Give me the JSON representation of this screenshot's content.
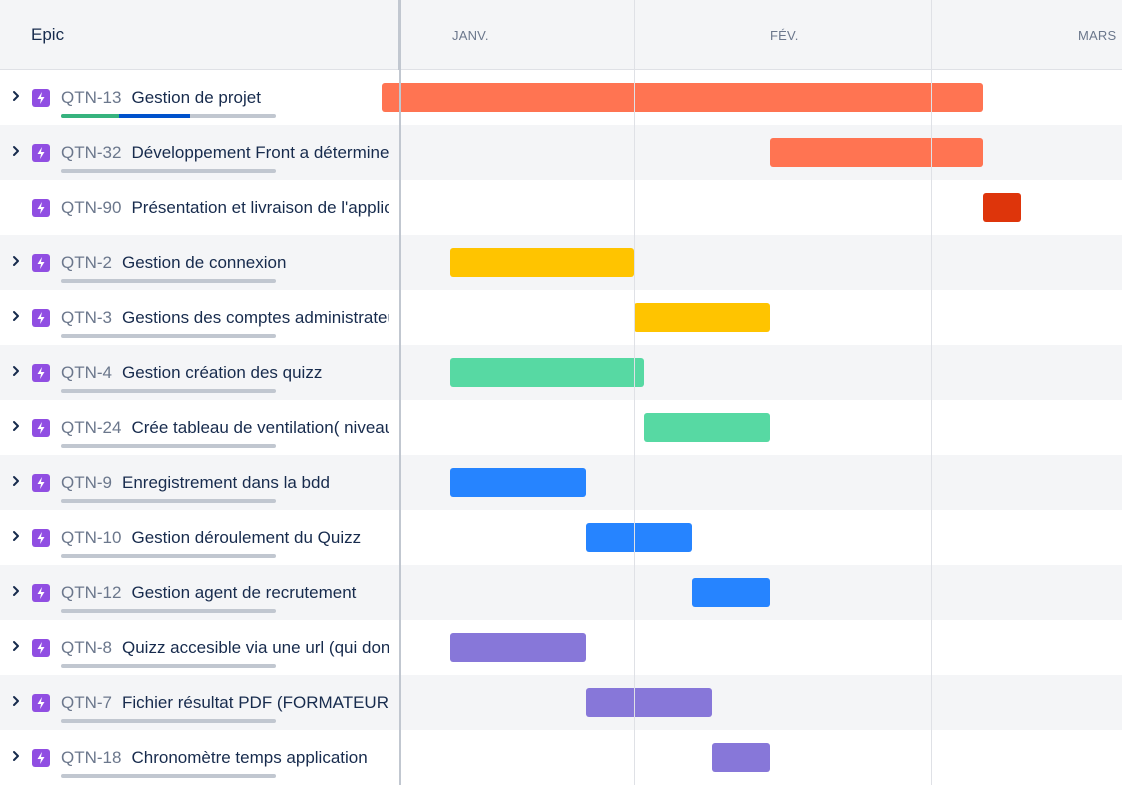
{
  "header": {
    "epic_label": "Epic"
  },
  "months": [
    "JANV.",
    "FÉV.",
    "MARS"
  ],
  "rows": [
    {
      "key": "QTN-13",
      "title": "Gestion de projet",
      "expandable": true,
      "progress": {
        "done": 0.27,
        "in_progress": 0.33
      },
      "bar": {
        "start": "Jan 06",
        "end": "Mar 09"
      },
      "color": "#ff7452"
    },
    {
      "key": "QTN-32",
      "title": "Développement Front a déterminer",
      "expandable": true,
      "progress": {
        "done": 0,
        "in_progress": 0
      },
      "bar": {
        "start": "Feb 15",
        "end": "Mar 09"
      },
      "color": "#ff7452"
    },
    {
      "key": "QTN-90",
      "title": "Présentation et livraison de l'application",
      "expandable": false,
      "progress": null,
      "bar": {
        "start": "Mar 09",
        "end": "Mar 13"
      },
      "color": "#de350b"
    },
    {
      "key": "QTN-2",
      "title": "Gestion de connexion",
      "expandable": true,
      "progress": {
        "done": 0,
        "in_progress": 0
      },
      "bar": {
        "start": "Jan 13",
        "end": "Feb 01"
      },
      "color": "#ffc400"
    },
    {
      "key": "QTN-3",
      "title": "Gestions des comptes administrateurs",
      "expandable": true,
      "progress": {
        "done": 0,
        "in_progress": 0
      },
      "bar": {
        "start": "Feb 01",
        "end": "Feb 15"
      },
      "color": "#ffc400"
    },
    {
      "key": "QTN-4",
      "title": "Gestion création des quizz",
      "expandable": true,
      "progress": {
        "done": 0,
        "in_progress": 0
      },
      "bar": {
        "start": "Jan 13",
        "end": "Feb 02"
      },
      "color": "#57d9a3"
    },
    {
      "key": "QTN-24",
      "title": "Crée tableau de ventilation( niveau)",
      "expandable": true,
      "progress": {
        "done": 0,
        "in_progress": 0
      },
      "bar": {
        "start": "Feb 02",
        "end": "Feb 15"
      },
      "color": "#57d9a3"
    },
    {
      "key": "QTN-9",
      "title": "Enregistrement dans la bdd",
      "expandable": true,
      "progress": {
        "done": 0,
        "in_progress": 0
      },
      "bar": {
        "start": "Jan 13",
        "end": "Jan 27"
      },
      "color": "#2684ff"
    },
    {
      "key": "QTN-10",
      "title": "Gestion déroulement du Quizz",
      "expandable": true,
      "progress": {
        "done": 0,
        "in_progress": 0
      },
      "bar": {
        "start": "Jan 27",
        "end": "Feb 07"
      },
      "color": "#2684ff"
    },
    {
      "key": "QTN-12",
      "title": "Gestion agent de recrutement",
      "expandable": true,
      "progress": {
        "done": 0,
        "in_progress": 0
      },
      "bar": {
        "start": "Feb 07",
        "end": "Feb 15"
      },
      "color": "#2684ff"
    },
    {
      "key": "QTN-8",
      "title": "Quizz accesible via une url (qui donne accès)",
      "expandable": true,
      "progress": {
        "done": 0,
        "in_progress": 0
      },
      "bar": {
        "start": "Jan 13",
        "end": "Jan 27"
      },
      "color": "#8777d9"
    },
    {
      "key": "QTN-7",
      "title": "Fichier résultat PDF (FORMATEUR)",
      "expandable": true,
      "progress": {
        "done": 0,
        "in_progress": 0
      },
      "bar": {
        "start": "Jan 27",
        "end": "Feb 09"
      },
      "color": "#8777d9"
    },
    {
      "key": "QTN-18",
      "title": "Chronomètre temps application",
      "expandable": true,
      "progress": {
        "done": 0,
        "in_progress": 0
      },
      "bar": {
        "start": "Feb 09",
        "end": "Feb 15"
      },
      "color": "#8777d9"
    }
  ]
}
